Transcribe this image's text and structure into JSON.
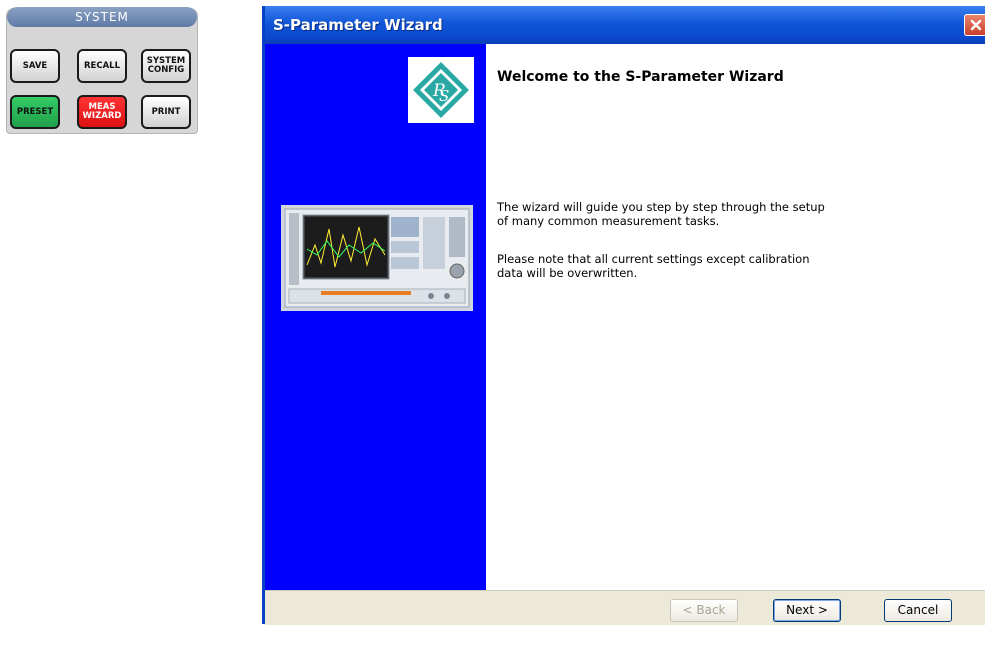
{
  "system_panel": {
    "header": "SYSTEM",
    "buttons": [
      {
        "label": "SAVE",
        "color": "#e0e0e0"
      },
      {
        "label": "RECALL",
        "color": "#e0e0e0"
      },
      {
        "label": "SYSTEM\nCONFIG",
        "color": "#e0e0e0"
      },
      {
        "label": "PRESET",
        "color": "#2cb85c"
      },
      {
        "label": "MEAS\nWIZARD",
        "color": "#ee2222"
      },
      {
        "label": "PRINT",
        "color": "#e0e0e0"
      }
    ]
  },
  "wizard": {
    "title": "S-Parameter Wizard",
    "heading": "Welcome to the S-Parameter Wizard",
    "paragraph1_line1": "The wizard will guide you step by step through the setup",
    "paragraph1_line2": "of many common measurement tasks.",
    "paragraph2_line1": "Please note that all current settings except calibration",
    "paragraph2_line2": "data will be overwritten.",
    "side_color": "#0000ff",
    "buttons": {
      "back": "< Back",
      "next": "Next >",
      "cancel": "Cancel"
    }
  },
  "icons": {
    "logo": "rohde-schwarz-logo",
    "close": "close-icon",
    "instrument": "network-analyzer-image"
  }
}
